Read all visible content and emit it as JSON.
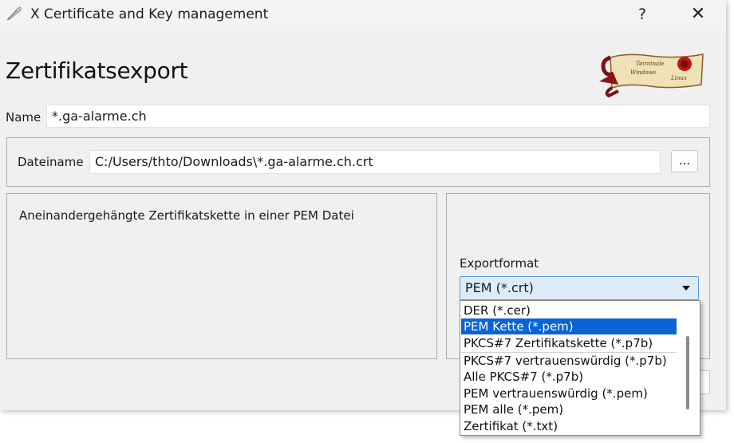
{
  "window": {
    "title": "X Certificate and Key management",
    "help_label": "?",
    "close_label": "✕"
  },
  "dialog": {
    "heading": "Zertifikatsexport",
    "logo_lines": [
      "Terminale",
      "Windows",
      "Linux"
    ]
  },
  "name": {
    "label": "Name",
    "value": "*.ga-alarme.ch"
  },
  "file": {
    "label": "Dateiname",
    "value": "C:/Users/thto/Downloads\\*.ga-alarme.ch.crt",
    "browse_label": "..."
  },
  "description": {
    "text": "Aneinandergehängte Zertifikatskette in einer PEM Datei"
  },
  "export_format": {
    "label": "Exportformat",
    "selected": "PEM (*.crt)",
    "options": [
      "DER (*.cer)",
      "PEM Kette (*.pem)",
      "PKCS#7 Zertifikatskette (*.p7b)",
      "PKCS#7 vertrauenswürdig (*.p7b)",
      "Alle PKCS#7 (*.p7b)",
      "PEM vertrauenswürdig (*.pem)",
      "PEM alle (*.pem)",
      "Zertifikat (*.txt)"
    ],
    "highlighted_option": "PEM Kette (*.pem)"
  },
  "colors": {
    "highlight": "#0a64d6",
    "select_bg": "#dcebf8",
    "window_bg": "#f0f0f0"
  }
}
